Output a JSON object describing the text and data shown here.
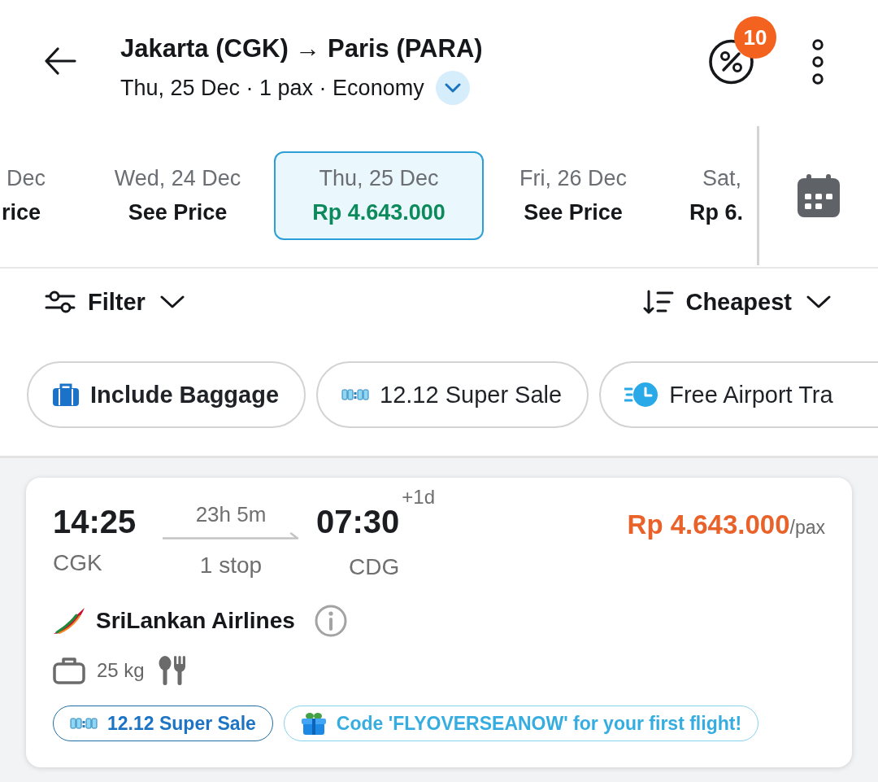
{
  "header": {
    "title": "Jakarta (CGK) → Paris (PARA)",
    "subtitle": "Thu, 25 Dec · 1 pax · Economy",
    "promo_count": "10"
  },
  "date_tabs": [
    {
      "day": "Dec",
      "price": "rice",
      "selected": false
    },
    {
      "day": "Wed, 24 Dec",
      "price": "See Price",
      "selected": false
    },
    {
      "day": "Thu, 25 Dec",
      "price": "Rp 4.643.000",
      "selected": true
    },
    {
      "day": "Fri, 26 Dec",
      "price": "See Price",
      "selected": false
    },
    {
      "day": "Sat,",
      "price": "Rp 6.",
      "selected": false
    }
  ],
  "toolbar": {
    "filter": "Filter",
    "sort": "Cheapest"
  },
  "quick_filters": [
    {
      "kind": "baggage",
      "label": "Include Baggage"
    },
    {
      "kind": "sale",
      "label": "12.12 Super Sale"
    },
    {
      "kind": "transfer",
      "label": "Free Airport Tra"
    }
  ],
  "flights": [
    {
      "departure_time": "14:25",
      "departure_airport": "CGK",
      "duration": "23h 5m",
      "stops": "1 stop",
      "arrival_time": "07:30",
      "day_offset": "+1d",
      "arrival_airport": "CDG",
      "price": "Rp 4.643.000",
      "price_unit": "/pax",
      "airline": "SriLankan Airlines",
      "baggage": "25 kg",
      "meal": true,
      "tags": [
        {
          "kind": "sale",
          "label": "12.12 Super Sale"
        },
        {
          "kind": "promo",
          "label": "Code 'FLYOVERSEANOW' for your first flight!"
        }
      ]
    }
  ]
}
